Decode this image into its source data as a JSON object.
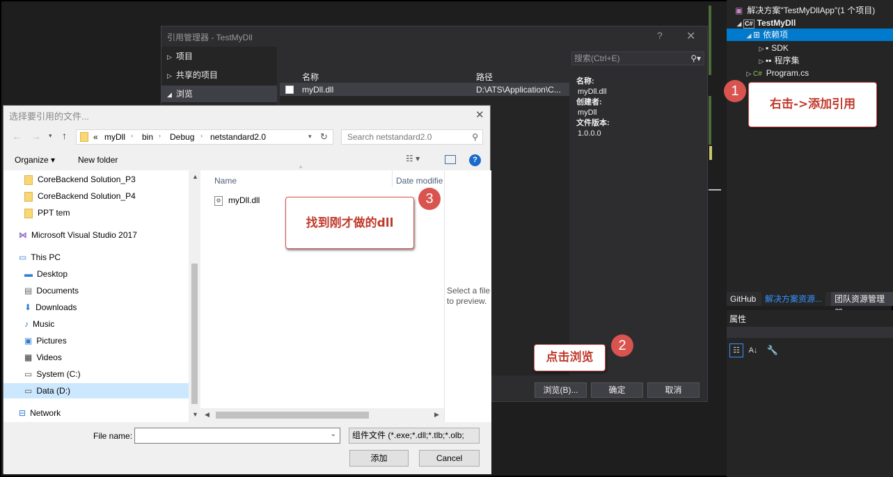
{
  "vs": {
    "solution_title": "解决方案\"TestMyDllApp\"(1 个项目)",
    "project": "TestMyDll",
    "dependencies": "依赖项",
    "sdk": "SDK",
    "assemblies": "程序集",
    "program": "Program.cs",
    "tabs": [
      "GitHub",
      "解决方案资源...",
      "团队资源管理器"
    ],
    "props_title": "属性"
  },
  "refmgr": {
    "title": "引用管理器 - TestMyDll",
    "help": "?",
    "close": "✕",
    "nav": [
      "项目",
      "共享的项目",
      "浏览"
    ],
    "col_name": "名称",
    "col_path": "路径",
    "row_name": "myDll.dll",
    "row_path": "D:\\ATS\\Application\\C...",
    "search_placeholder": "搜索(Ctrl+E)",
    "detail_name_label": "名称:",
    "detail_name": "myDll.dll",
    "detail_creator_label": "创建者:",
    "detail_creator": "myDll",
    "detail_version_label": "文件版本:",
    "detail_version": "1.0.0.0",
    "btn_browse": "浏览(B)...",
    "btn_ok": "确定",
    "btn_cancel": "取消"
  },
  "callouts": {
    "c1": "右击->添加引用",
    "c2": "点击浏览",
    "c3": "找到刚才做的dll",
    "n1": "1",
    "n2": "2",
    "n3": "3"
  },
  "fdlg": {
    "title": "选择要引用的文件...",
    "close": "✕",
    "crumbs": [
      "«",
      "myDll",
      "bin",
      "Debug",
      "netstandard2.0"
    ],
    "search_placeholder": "Search netstandard2.0",
    "organize": "Organize ▾",
    "new_folder": "New folder",
    "nav": [
      "CoreBackend Solution_P3",
      "CoreBackend Solution_P4",
      "PPT tem",
      "Microsoft Visual Studio 2017",
      "This PC",
      "Desktop",
      "Documents",
      "Downloads",
      "Music",
      "Pictures",
      "Videos",
      "System (C:)",
      "Data (D:)",
      "Network"
    ],
    "col_name": "Name",
    "col_date": "Date modifie",
    "file": "myDll.dll",
    "preview": "Select a file to preview.",
    "filename_label": "File name:",
    "filetype": "组件文件 (*.exe;*.dll;*.tlb;*.olb;",
    "btn_add": "添加",
    "btn_cancel": "Cancel"
  },
  "colors": {
    "vs_accent": "#007acc",
    "callout_red": "#d9534f",
    "selection": "#cce8ff"
  }
}
